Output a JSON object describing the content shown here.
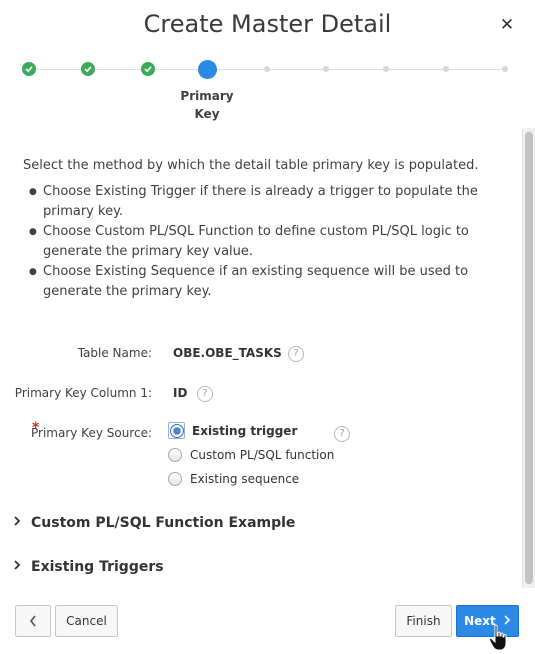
{
  "dialog": {
    "title": "Create Master Detail",
    "close_icon": "✕"
  },
  "wizard": {
    "steps_total": 9,
    "completed_steps": 3,
    "current_step": 4,
    "current_step_label": "Primary Key",
    "colors": {
      "done": "#3bab5a",
      "current": "#2d89e6",
      "future": "#d6d6d6"
    }
  },
  "content": {
    "intro": "Select the method by which the detail table primary key is populated.",
    "bullets": [
      "Choose Existing Trigger if there is already a trigger to populate the primary key.",
      "Choose Custom PL/SQL Function to define custom PL/SQL logic to generate the primary key value.",
      "Choose Existing Sequence if an existing sequence will be used to generate the primary key."
    ]
  },
  "form": {
    "table_name_label": "Table Name:",
    "table_name_value": "OBE.OBE_TASKS",
    "pk_column_label": "Primary Key Column 1:",
    "pk_column_value": "ID",
    "required_marker": "*",
    "pk_source_label": "Primary Key Source:",
    "pk_source_options": [
      "Existing trigger",
      "Custom PL/SQL function",
      "Existing sequence"
    ],
    "pk_source_selected": "Existing trigger",
    "help_glyph": "?"
  },
  "sections": [
    {
      "title": "Custom PL/SQL Function Example",
      "icon": "chevron-right-icon"
    },
    {
      "title": "Existing Triggers",
      "icon": "chevron-right-icon"
    }
  ],
  "footer": {
    "back_icon": "chevron-left-icon",
    "cancel_label": "Cancel",
    "finish_label": "Finish",
    "next_label": "Next"
  },
  "accent_color": "#2d89e6"
}
